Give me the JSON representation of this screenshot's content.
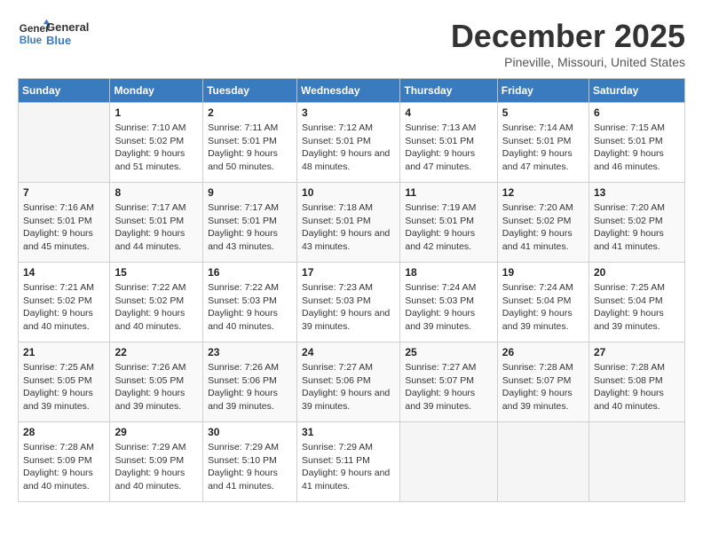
{
  "logo": {
    "line1": "General",
    "line2": "Blue"
  },
  "title": "December 2025",
  "subtitle": "Pineville, Missouri, United States",
  "days_header": [
    "Sunday",
    "Monday",
    "Tuesday",
    "Wednesday",
    "Thursday",
    "Friday",
    "Saturday"
  ],
  "weeks": [
    [
      {
        "day": "",
        "sunrise": "",
        "sunset": "",
        "daylight": ""
      },
      {
        "day": "1",
        "sunrise": "Sunrise: 7:10 AM",
        "sunset": "Sunset: 5:02 PM",
        "daylight": "Daylight: 9 hours and 51 minutes."
      },
      {
        "day": "2",
        "sunrise": "Sunrise: 7:11 AM",
        "sunset": "Sunset: 5:01 PM",
        "daylight": "Daylight: 9 hours and 50 minutes."
      },
      {
        "day": "3",
        "sunrise": "Sunrise: 7:12 AM",
        "sunset": "Sunset: 5:01 PM",
        "daylight": "Daylight: 9 hours and 48 minutes."
      },
      {
        "day": "4",
        "sunrise": "Sunrise: 7:13 AM",
        "sunset": "Sunset: 5:01 PM",
        "daylight": "Daylight: 9 hours and 47 minutes."
      },
      {
        "day": "5",
        "sunrise": "Sunrise: 7:14 AM",
        "sunset": "Sunset: 5:01 PM",
        "daylight": "Daylight: 9 hours and 47 minutes."
      },
      {
        "day": "6",
        "sunrise": "Sunrise: 7:15 AM",
        "sunset": "Sunset: 5:01 PM",
        "daylight": "Daylight: 9 hours and 46 minutes."
      }
    ],
    [
      {
        "day": "7",
        "sunrise": "Sunrise: 7:16 AM",
        "sunset": "Sunset: 5:01 PM",
        "daylight": "Daylight: 9 hours and 45 minutes."
      },
      {
        "day": "8",
        "sunrise": "Sunrise: 7:17 AM",
        "sunset": "Sunset: 5:01 PM",
        "daylight": "Daylight: 9 hours and 44 minutes."
      },
      {
        "day": "9",
        "sunrise": "Sunrise: 7:17 AM",
        "sunset": "Sunset: 5:01 PM",
        "daylight": "Daylight: 9 hours and 43 minutes."
      },
      {
        "day": "10",
        "sunrise": "Sunrise: 7:18 AM",
        "sunset": "Sunset: 5:01 PM",
        "daylight": "Daylight: 9 hours and 43 minutes."
      },
      {
        "day": "11",
        "sunrise": "Sunrise: 7:19 AM",
        "sunset": "Sunset: 5:01 PM",
        "daylight": "Daylight: 9 hours and 42 minutes."
      },
      {
        "day": "12",
        "sunrise": "Sunrise: 7:20 AM",
        "sunset": "Sunset: 5:02 PM",
        "daylight": "Daylight: 9 hours and 41 minutes."
      },
      {
        "day": "13",
        "sunrise": "Sunrise: 7:20 AM",
        "sunset": "Sunset: 5:02 PM",
        "daylight": "Daylight: 9 hours and 41 minutes."
      }
    ],
    [
      {
        "day": "14",
        "sunrise": "Sunrise: 7:21 AM",
        "sunset": "Sunset: 5:02 PM",
        "daylight": "Daylight: 9 hours and 40 minutes."
      },
      {
        "day": "15",
        "sunrise": "Sunrise: 7:22 AM",
        "sunset": "Sunset: 5:02 PM",
        "daylight": "Daylight: 9 hours and 40 minutes."
      },
      {
        "day": "16",
        "sunrise": "Sunrise: 7:22 AM",
        "sunset": "Sunset: 5:03 PM",
        "daylight": "Daylight: 9 hours and 40 minutes."
      },
      {
        "day": "17",
        "sunrise": "Sunrise: 7:23 AM",
        "sunset": "Sunset: 5:03 PM",
        "daylight": "Daylight: 9 hours and 39 minutes."
      },
      {
        "day": "18",
        "sunrise": "Sunrise: 7:24 AM",
        "sunset": "Sunset: 5:03 PM",
        "daylight": "Daylight: 9 hours and 39 minutes."
      },
      {
        "day": "19",
        "sunrise": "Sunrise: 7:24 AM",
        "sunset": "Sunset: 5:04 PM",
        "daylight": "Daylight: 9 hours and 39 minutes."
      },
      {
        "day": "20",
        "sunrise": "Sunrise: 7:25 AM",
        "sunset": "Sunset: 5:04 PM",
        "daylight": "Daylight: 9 hours and 39 minutes."
      }
    ],
    [
      {
        "day": "21",
        "sunrise": "Sunrise: 7:25 AM",
        "sunset": "Sunset: 5:05 PM",
        "daylight": "Daylight: 9 hours and 39 minutes."
      },
      {
        "day": "22",
        "sunrise": "Sunrise: 7:26 AM",
        "sunset": "Sunset: 5:05 PM",
        "daylight": "Daylight: 9 hours and 39 minutes."
      },
      {
        "day": "23",
        "sunrise": "Sunrise: 7:26 AM",
        "sunset": "Sunset: 5:06 PM",
        "daylight": "Daylight: 9 hours and 39 minutes."
      },
      {
        "day": "24",
        "sunrise": "Sunrise: 7:27 AM",
        "sunset": "Sunset: 5:06 PM",
        "daylight": "Daylight: 9 hours and 39 minutes."
      },
      {
        "day": "25",
        "sunrise": "Sunrise: 7:27 AM",
        "sunset": "Sunset: 5:07 PM",
        "daylight": "Daylight: 9 hours and 39 minutes."
      },
      {
        "day": "26",
        "sunrise": "Sunrise: 7:28 AM",
        "sunset": "Sunset: 5:07 PM",
        "daylight": "Daylight: 9 hours and 39 minutes."
      },
      {
        "day": "27",
        "sunrise": "Sunrise: 7:28 AM",
        "sunset": "Sunset: 5:08 PM",
        "daylight": "Daylight: 9 hours and 40 minutes."
      }
    ],
    [
      {
        "day": "28",
        "sunrise": "Sunrise: 7:28 AM",
        "sunset": "Sunset: 5:09 PM",
        "daylight": "Daylight: 9 hours and 40 minutes."
      },
      {
        "day": "29",
        "sunrise": "Sunrise: 7:29 AM",
        "sunset": "Sunset: 5:09 PM",
        "daylight": "Daylight: 9 hours and 40 minutes."
      },
      {
        "day": "30",
        "sunrise": "Sunrise: 7:29 AM",
        "sunset": "Sunset: 5:10 PM",
        "daylight": "Daylight: 9 hours and 41 minutes."
      },
      {
        "day": "31",
        "sunrise": "Sunrise: 7:29 AM",
        "sunset": "Sunset: 5:11 PM",
        "daylight": "Daylight: 9 hours and 41 minutes."
      },
      {
        "day": "",
        "sunrise": "",
        "sunset": "",
        "daylight": ""
      },
      {
        "day": "",
        "sunrise": "",
        "sunset": "",
        "daylight": ""
      },
      {
        "day": "",
        "sunrise": "",
        "sunset": "",
        "daylight": ""
      }
    ]
  ]
}
